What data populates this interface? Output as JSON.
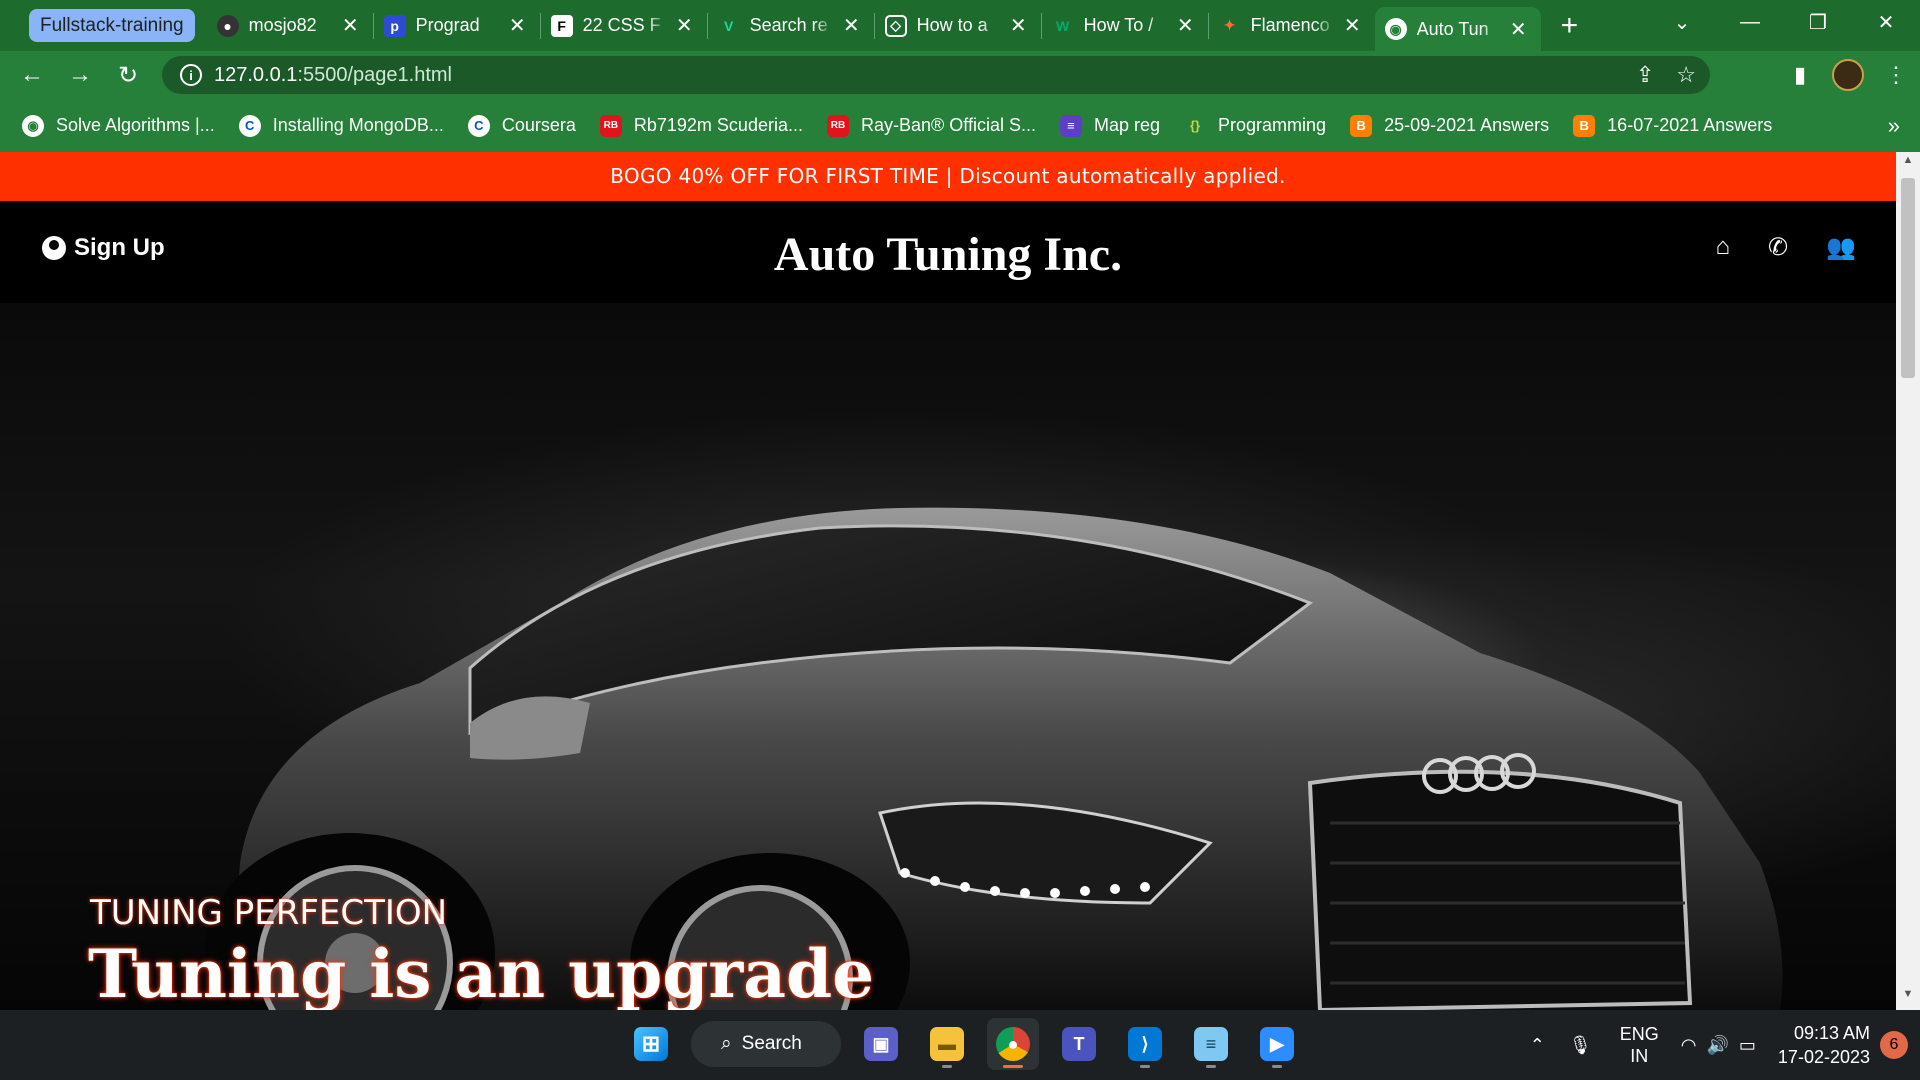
{
  "browser": {
    "tab_group": "Fullstack-training",
    "tabs": [
      {
        "title": "mosjo82",
        "icon": "github-icon"
      },
      {
        "title": "Prograd",
        "icon": "prograd-icon"
      },
      {
        "title": "22 CSS F",
        "icon": "frontend-icon"
      },
      {
        "title": "Search re",
        "icon": "vuetify-icon"
      },
      {
        "title": "How to a",
        "icon": "codepen-icon"
      },
      {
        "title": "How To /",
        "icon": "w3schools-icon"
      },
      {
        "title": "Flamenco",
        "icon": "flamenco-icon"
      },
      {
        "title": "Auto Tun",
        "icon": "globe-icon",
        "active": true
      }
    ],
    "url_host": "127.0.0.1",
    "url_path": ":5500/page1.html",
    "bookmarks": [
      {
        "label": "Solve Algorithms |...",
        "icon": "hackerrank-icon"
      },
      {
        "label": "Installing MongoDB...",
        "icon": "coursera-icon"
      },
      {
        "label": "Coursera",
        "icon": "coursera-icon"
      },
      {
        "label": "Rb7192m Scuderia...",
        "icon": "rayban-icon"
      },
      {
        "label": "Ray-Ban® Official S...",
        "icon": "rayban-icon"
      },
      {
        "label": "Map reg",
        "icon": "list-icon"
      },
      {
        "label": "Programming",
        "icon": "code-icon"
      },
      {
        "label": "25-09-2021 Answers",
        "icon": "blogger-icon"
      },
      {
        "label": "16-07-2021 Answers",
        "icon": "blogger-icon"
      }
    ]
  },
  "page": {
    "promo": "BOGO 40% OFF FOR FIRST TIME | Discount automatically applied.",
    "signup": "Sign Up",
    "brand": "Auto Tuning Inc.",
    "hero_tag": "TUNING PERFECTION",
    "hero_headline": "Tuning is an upgrade"
  },
  "taskbar": {
    "search": "Search",
    "lang_1": "ENG",
    "lang_2": "IN",
    "time": "09:13 AM",
    "date": "17-02-2023",
    "notifications": "6"
  },
  "colors": {
    "chrome_green": "#26803a",
    "promo_red": "#ff3000"
  }
}
